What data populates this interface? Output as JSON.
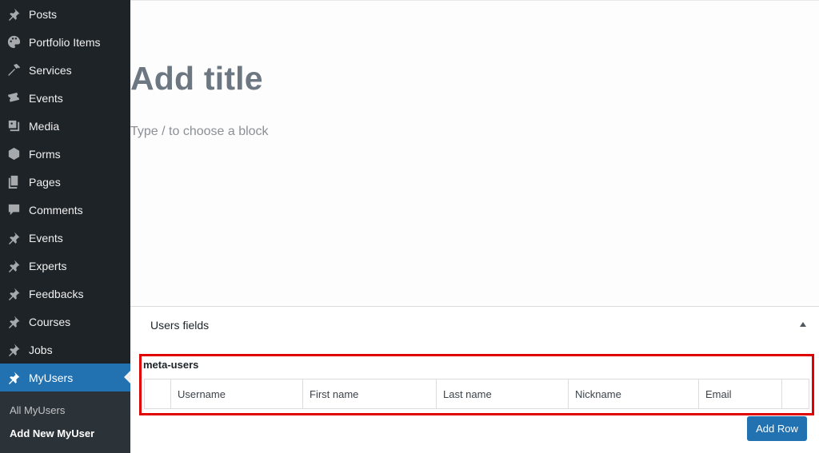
{
  "sidebar": {
    "items": [
      {
        "label": "Posts",
        "icon": "pin-icon"
      },
      {
        "label": "Portfolio Items",
        "icon": "palette-icon"
      },
      {
        "label": "Services",
        "icon": "hammer-icon"
      },
      {
        "label": "Events",
        "icon": "tickets-icon"
      },
      {
        "label": "Media",
        "icon": "media-icon"
      },
      {
        "label": "Forms",
        "icon": "forms-icon"
      },
      {
        "label": "Pages",
        "icon": "pages-icon"
      },
      {
        "label": "Comments",
        "icon": "comment-icon"
      },
      {
        "label": "Events",
        "icon": "pin-icon"
      },
      {
        "label": "Experts",
        "icon": "pin-icon"
      },
      {
        "label": "Feedbacks",
        "icon": "pin-icon"
      },
      {
        "label": "Courses",
        "icon": "pin-icon"
      },
      {
        "label": "Jobs",
        "icon": "pin-icon"
      },
      {
        "label": "MyUsers",
        "icon": "pin-icon",
        "active": true
      }
    ],
    "submenu": [
      {
        "label": "All MyUsers"
      },
      {
        "label": "Add New MyUser",
        "current": true
      }
    ]
  },
  "editor": {
    "title_placeholder": "Add title",
    "block_placeholder": "Type / to choose a block"
  },
  "metabox": {
    "title": "Users fields",
    "field_label": "meta-users",
    "columns": [
      "Username",
      "First name",
      "Last name",
      "Nickname",
      "Email"
    ],
    "add_row_label": "Add Row"
  },
  "colors": {
    "sidebar_bg": "#1d2327",
    "accent": "#2271b1",
    "highlight": "#e00000"
  }
}
